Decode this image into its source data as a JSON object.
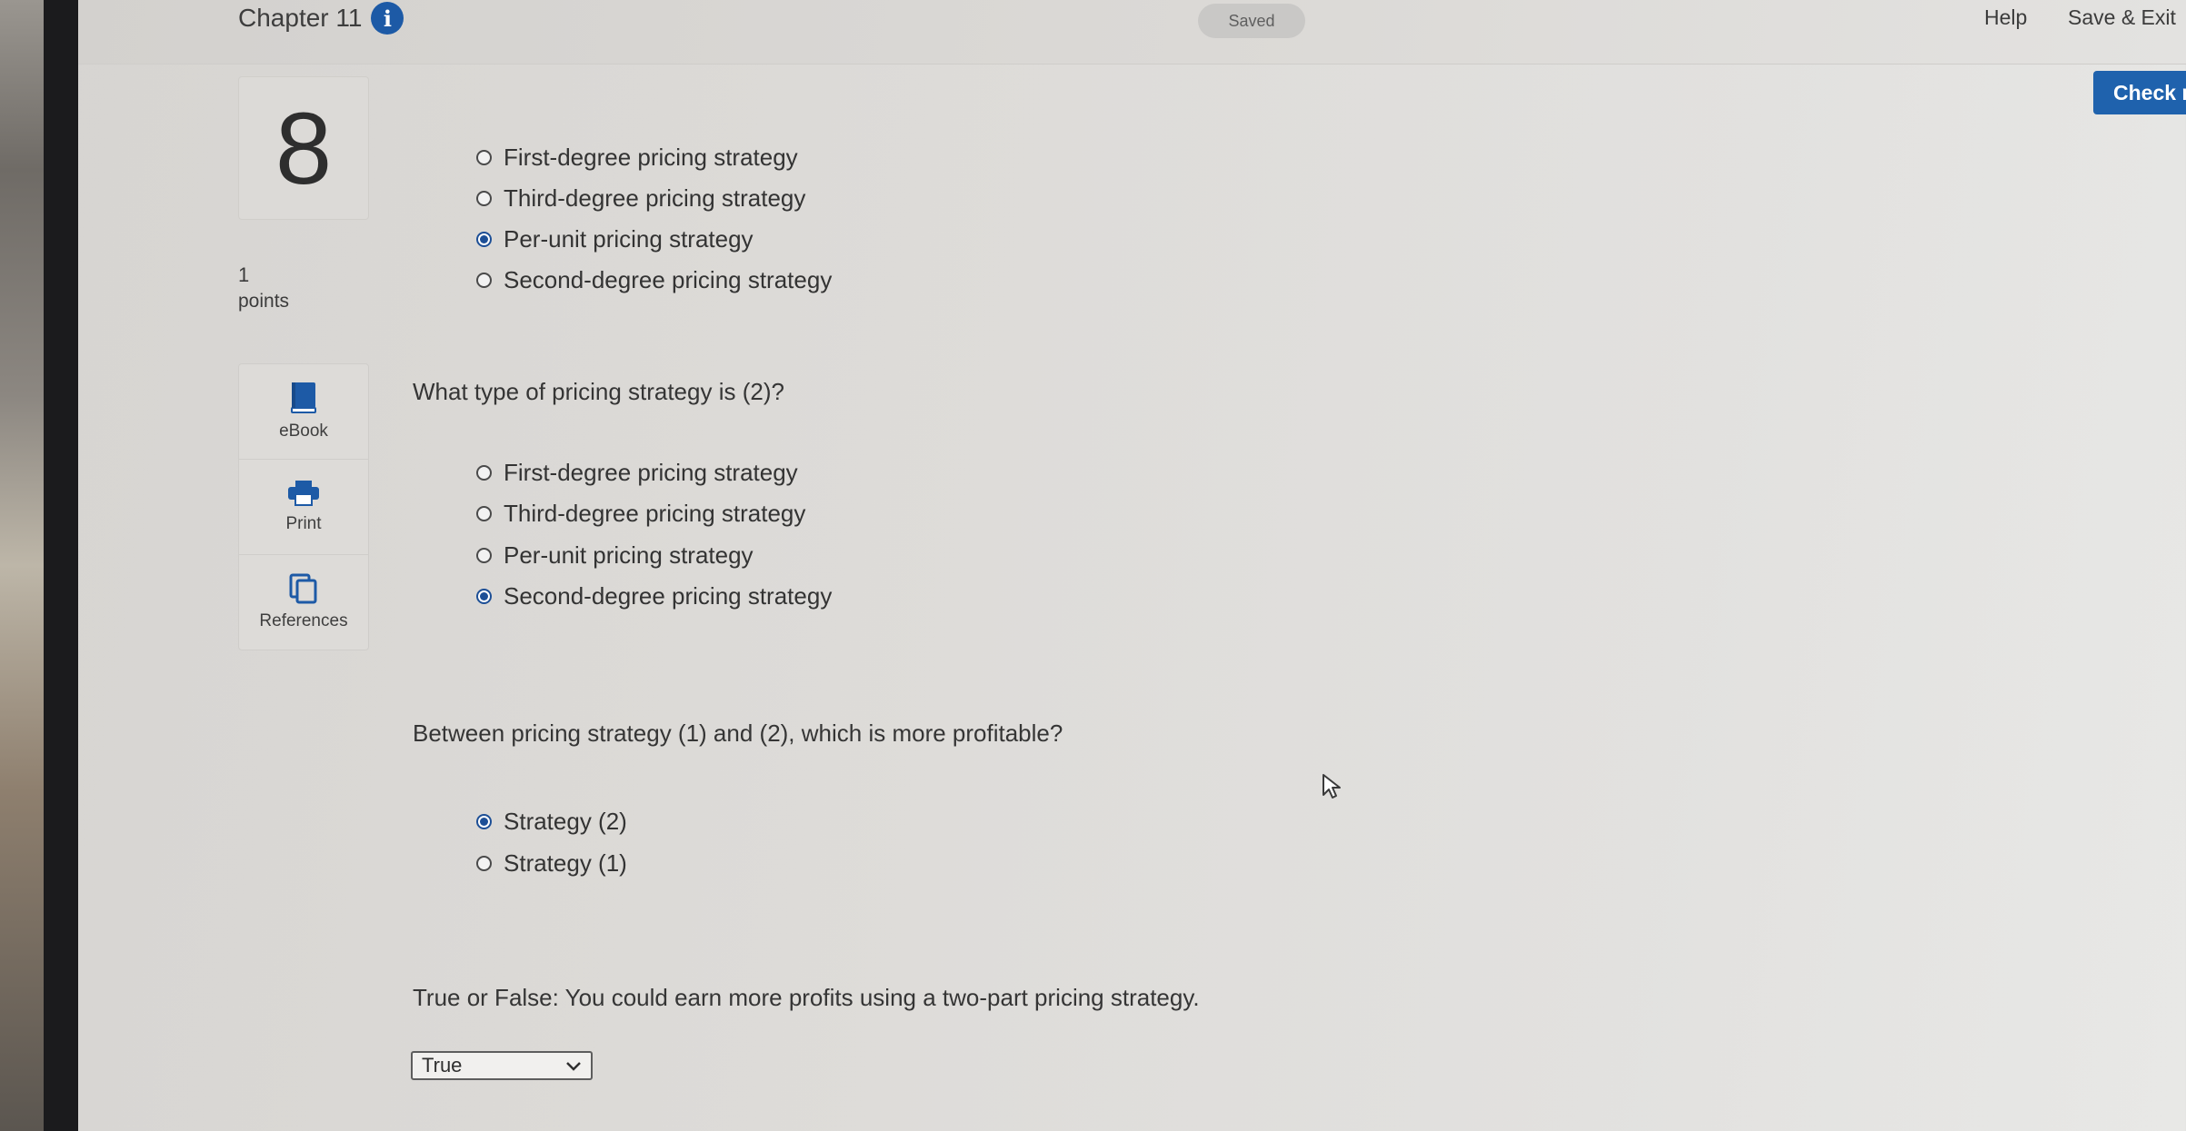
{
  "header": {
    "chapter_title": "Chapter 11",
    "info_icon": "info-icon",
    "saved_status": "Saved",
    "help_label": "Help",
    "save_exit_label": "Save & Exit",
    "check_label": "Check r"
  },
  "question_number": "8",
  "points": {
    "value": "1",
    "label": "points"
  },
  "tools": [
    {
      "label": "eBook",
      "icon": "book-icon"
    },
    {
      "label": "Print",
      "icon": "printer-icon"
    },
    {
      "label": "References",
      "icon": "references-icon"
    }
  ],
  "part1": {
    "options": [
      {
        "label": "First-degree pricing strategy",
        "selected": false
      },
      {
        "label": "Third-degree pricing strategy",
        "selected": false
      },
      {
        "label": "Per-unit pricing strategy",
        "selected": true
      },
      {
        "label": "Second-degree pricing strategy",
        "selected": false
      }
    ]
  },
  "part2": {
    "question": "What type of pricing strategy is (2)?",
    "options": [
      {
        "label": "First-degree pricing strategy",
        "selected": false
      },
      {
        "label": "Third-degree pricing strategy",
        "selected": false
      },
      {
        "label": "Per-unit pricing strategy",
        "selected": false
      },
      {
        "label": "Second-degree pricing strategy",
        "selected": true
      }
    ]
  },
  "part3": {
    "question": "Between pricing strategy (1) and (2), which is more profitable?",
    "options": [
      {
        "label": "Strategy (2)",
        "selected": true
      },
      {
        "label": "Strategy (1)",
        "selected": false
      }
    ]
  },
  "part4": {
    "question": "True or False: You could earn more profits using a two-part pricing strategy.",
    "selected_value": "True"
  },
  "colors": {
    "accent": "#1f62ad",
    "radio_selected": "#1d4f96",
    "background": "#dcdad7"
  }
}
